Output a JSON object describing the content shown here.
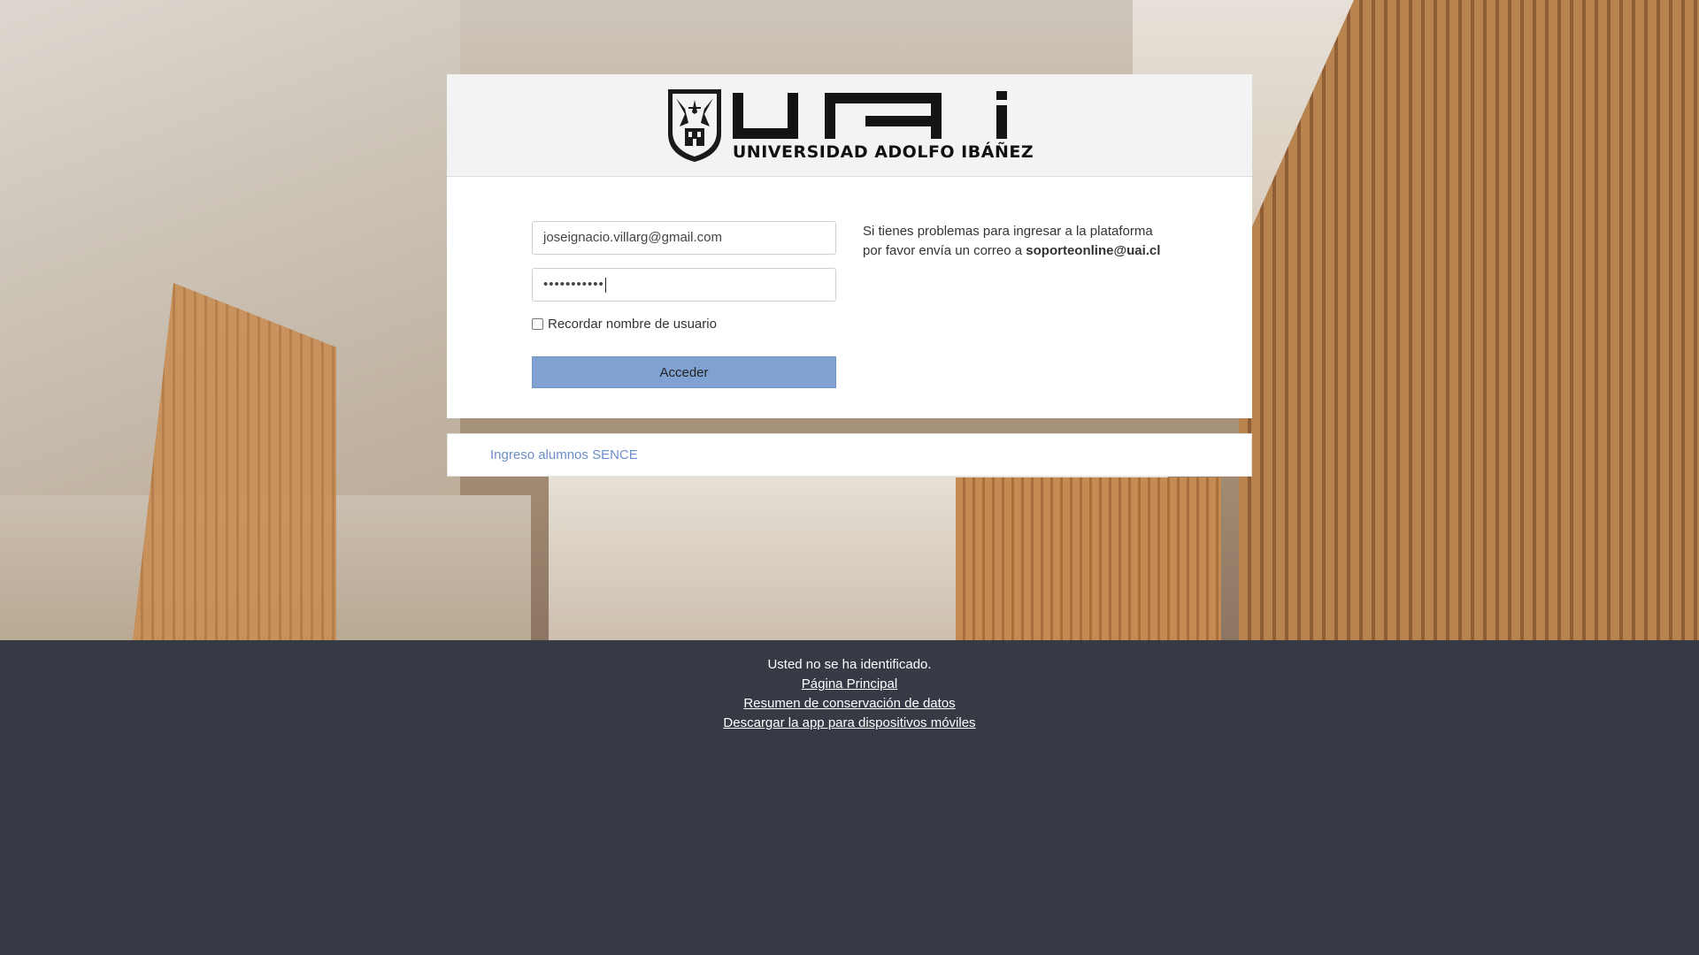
{
  "logo": {
    "university_name": "UNIVERSIDAD ADOLFO IBÁÑEZ",
    "letters": "UAI"
  },
  "login": {
    "username_value": "joseignacio.villarg@gmail.com",
    "password_masked": "•••••••••••",
    "remember_label": "Recordar nombre de usuario",
    "remember_checked": false,
    "submit_label": "Acceder"
  },
  "help": {
    "line1": "Si tienes problemas para ingresar a la plataforma",
    "line2_prefix": "por favor envía un correo a ",
    "email": "soporteonline@uai.cl"
  },
  "sence": {
    "link_label": "Ingreso alumnos SENCE"
  },
  "footer": {
    "status": "Usted no se ha identificado.",
    "links": [
      "Página Principal",
      "Resumen de conservación de datos",
      "Descargar la app para dispositivos móviles"
    ]
  },
  "colors": {
    "button_bg": "#7fa2d2",
    "link": "#6b8ec8",
    "footer_bg": "#353a45"
  }
}
